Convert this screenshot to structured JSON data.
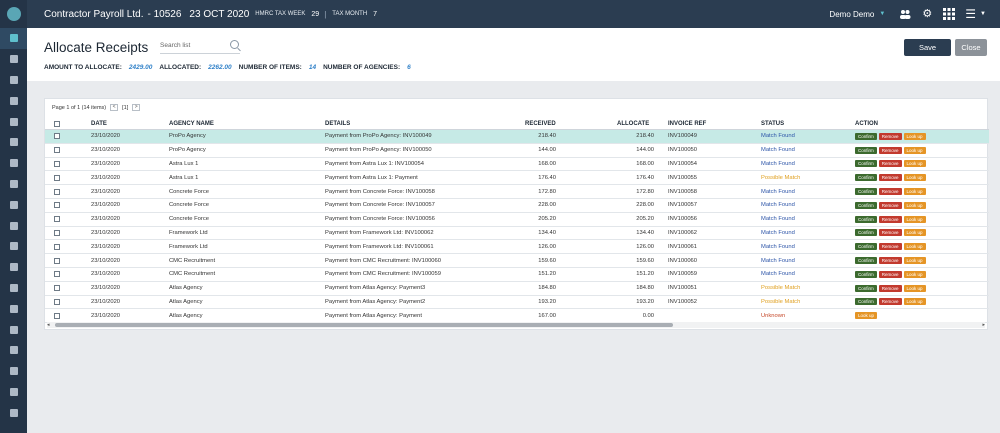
{
  "topbar": {
    "company": "Contractor Payroll Ltd.",
    "company_id": "- 10526",
    "date": "23 OCT 2020",
    "tax_week_label": "HMRC TAX WEEK",
    "tax_week": "29",
    "tax_month_label": "TAX MONTH",
    "tax_month": "7",
    "user": "Demo Demo",
    "icons": [
      "people-icon",
      "gear-icon",
      "apps-grid-icon",
      "menu-icon"
    ]
  },
  "header": {
    "title": "Allocate Receipts",
    "search_placeholder": "Search list",
    "amount_label": "AMOUNT TO ALLOCATE:",
    "amount_value": "2429.00",
    "allocated_label": "ALLOCATED:",
    "allocated_value": "2262.00",
    "items_label": "NUMBER OF ITEMS:",
    "items_value": "14",
    "agencies_label": "NUMBER OF AGENCIES:",
    "agencies_value": "6",
    "save": "Save",
    "close": "Close"
  },
  "pager": {
    "text": "Page 1 of 1 (14 items)",
    "page": "[1]",
    "prev": "<",
    "next": ">"
  },
  "columns": [
    "DATE",
    "AGENCY NAME",
    "DETAILS",
    "RECEIVED",
    "ALLOCATE",
    "INVOICE REF",
    "STATUS",
    "ACTION"
  ],
  "actions": {
    "confirm": "Confirm",
    "remove": "Remove",
    "lookup": "Look up"
  },
  "rows": [
    {
      "date": "23/10/2020",
      "agency": "ProPo Agency",
      "details": "Payment from ProPo Agency: INV100049",
      "received": "218.40",
      "allocate": "218.40",
      "invoice": "INV100049",
      "status": "Match Found",
      "status_type": "match"
    },
    {
      "date": "23/10/2020",
      "agency": "ProPo Agency",
      "details": "Payment from ProPo Agency: INV100050",
      "received": "144.00",
      "allocate": "144.00",
      "invoice": "INV100050",
      "status": "Match Found",
      "status_type": "match"
    },
    {
      "date": "23/10/2020",
      "agency": "Astra Lux 1",
      "details": "Payment from Astra Lux 1: INV100054",
      "received": "168.00",
      "allocate": "168.00",
      "invoice": "INV100054",
      "status": "Match Found",
      "status_type": "match"
    },
    {
      "date": "23/10/2020",
      "agency": "Astra Lux 1",
      "details": "Payment from Astra Lux 1: Payment",
      "received": "176.40",
      "allocate": "176.40",
      "invoice": "INV100055",
      "status": "Possible Match",
      "status_type": "possible"
    },
    {
      "date": "23/10/2020",
      "agency": "Concrete Force",
      "details": "Payment from Concrete Force: INV100058",
      "received": "172.80",
      "allocate": "172.80",
      "invoice": "INV100058",
      "status": "Match Found",
      "status_type": "match"
    },
    {
      "date": "23/10/2020",
      "agency": "Concrete Force",
      "details": "Payment from Concrete Force: INV100057",
      "received": "228.00",
      "allocate": "228.00",
      "invoice": "INV100057",
      "status": "Match Found",
      "status_type": "match"
    },
    {
      "date": "23/10/2020",
      "agency": "Concrete Force",
      "details": "Payment from Concrete Force: INV100056",
      "received": "205.20",
      "allocate": "205.20",
      "invoice": "INV100056",
      "status": "Match Found",
      "status_type": "match"
    },
    {
      "date": "23/10/2020",
      "agency": "Framework Ltd",
      "details": "Payment from Framework Ltd: INV100062",
      "received": "134.40",
      "allocate": "134.40",
      "invoice": "INV100062",
      "status": "Match Found",
      "status_type": "match"
    },
    {
      "date": "23/10/2020",
      "agency": "Framework Ltd",
      "details": "Payment from Framework Ltd: INV100061",
      "received": "126.00",
      "allocate": "126.00",
      "invoice": "INV100061",
      "status": "Match Found",
      "status_type": "match"
    },
    {
      "date": "23/10/2020",
      "agency": "CMC Recruitment",
      "details": "Payment from CMC Recruitment: INV100060",
      "received": "159.60",
      "allocate": "159.60",
      "invoice": "INV100060",
      "status": "Match Found",
      "status_type": "match"
    },
    {
      "date": "23/10/2020",
      "agency": "CMC Recruitment",
      "details": "Payment from CMC Recruitment: INV100059",
      "received": "151.20",
      "allocate": "151.20",
      "invoice": "INV100059",
      "status": "Match Found",
      "status_type": "match"
    },
    {
      "date": "23/10/2020",
      "agency": "Atlas Agency",
      "details": "Payment from Atlas Agency: Payment3",
      "received": "184.80",
      "allocate": "184.80",
      "invoice": "INV100051",
      "status": "Possible Match",
      "status_type": "possible"
    },
    {
      "date": "23/10/2020",
      "agency": "Atlas Agency",
      "details": "Payment from Atlas Agency: Payment2",
      "received": "193.20",
      "allocate": "193.20",
      "invoice": "INV100052",
      "status": "Possible Match",
      "status_type": "possible"
    },
    {
      "date": "23/10/2020",
      "agency": "Atlas Agency",
      "details": "Payment from Atlas Agency: Payment",
      "received": "167.00",
      "allocate": "0.00",
      "invoice": "",
      "status": "Unknown",
      "status_type": "unknown"
    }
  ],
  "colors": {
    "sidebar": "#243447",
    "topbar": "#2b3d51",
    "selected_row": "#c6eae6",
    "confirm": "#3c6a2e",
    "remove": "#c23a2e",
    "lookup": "#e59526",
    "match": "#2d55a8",
    "possible": "#e0a020",
    "unknown": "#c64a2c"
  }
}
